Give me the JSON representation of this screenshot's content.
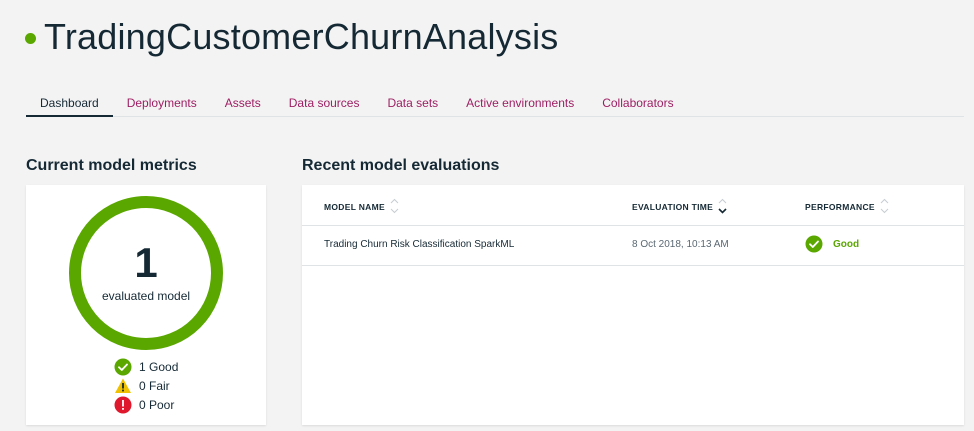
{
  "project": {
    "title": "TradingCustomerChurnAnalysis",
    "status_color": "#5aa700"
  },
  "tabs": [
    {
      "label": "Dashboard",
      "active": true
    },
    {
      "label": "Deployments",
      "active": false
    },
    {
      "label": "Assets",
      "active": false
    },
    {
      "label": "Data sources",
      "active": false
    },
    {
      "label": "Data sets",
      "active": false
    },
    {
      "label": "Active environments",
      "active": false
    },
    {
      "label": "Collaborators",
      "active": false
    }
  ],
  "metrics": {
    "title": "Current model metrics",
    "count": "1",
    "caption": "evaluated model",
    "legend": [
      {
        "label": "1 Good",
        "icon": "check-circle-icon",
        "color": "#5aa700"
      },
      {
        "label": "0 Fair",
        "icon": "warning-triangle-icon",
        "color": "#efc100"
      },
      {
        "label": "0 Poor",
        "icon": "error-circle-icon",
        "color": "#e0182d"
      }
    ]
  },
  "evaluations": {
    "title": "Recent model evaluations",
    "columns": [
      "MODEL NAME",
      "EVALUATION TIME",
      "PERFORMANCE"
    ],
    "rows": [
      {
        "model_name": "Trading Churn Risk Classification SparkML",
        "evaluation_time": "8 Oct 2018, 10:13 AM",
        "performance": "Good"
      }
    ]
  },
  "colors": {
    "accent": "#9d1f63",
    "good": "#5aa700",
    "fair": "#efc100",
    "poor": "#e0182d"
  }
}
